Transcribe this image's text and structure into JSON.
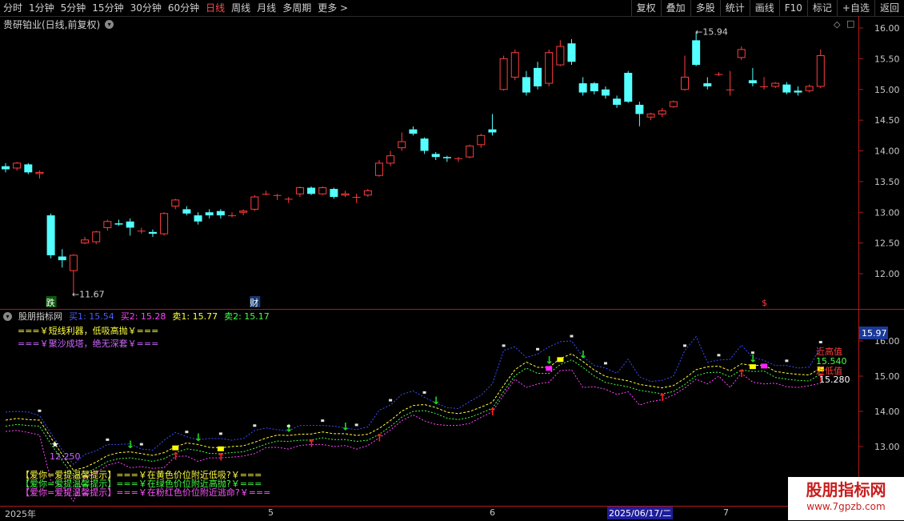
{
  "toolbar": {
    "left": [
      {
        "label": "分时",
        "active": false
      },
      {
        "label": "1分钟",
        "active": false
      },
      {
        "label": "5分钟",
        "active": false
      },
      {
        "label": "15分钟",
        "active": false
      },
      {
        "label": "30分钟",
        "active": false
      },
      {
        "label": "60分钟",
        "active": false
      },
      {
        "label": "日线",
        "active": true
      },
      {
        "label": "周线",
        "active": false
      },
      {
        "label": "月线",
        "active": false
      },
      {
        "label": "多周期",
        "active": false
      },
      {
        "label": "更多 >",
        "active": false
      }
    ],
    "right": [
      "复权",
      "叠加",
      "多股",
      "统计",
      "画线",
      "F10",
      "标记",
      "+自选",
      "返回"
    ]
  },
  "kline": {
    "title": "贵研铂业(日线,前复权)",
    "yticks": [
      "16.00",
      "15.50",
      "15.00",
      "14.50",
      "14.00",
      "13.50",
      "13.00",
      "12.50",
      "12.00"
    ],
    "high_label": "15.94",
    "low_label": "11.67",
    "marker_die": "跌",
    "marker_cai": "财",
    "marker_s": "$",
    "candles": [
      [
        13.75,
        13.7,
        13.8,
        13.65
      ],
      [
        13.72,
        13.8,
        13.82,
        13.68
      ],
      [
        13.78,
        13.65,
        13.8,
        13.62
      ],
      [
        13.63,
        13.65,
        13.68,
        13.55
      ],
      [
        12.95,
        12.3,
        12.98,
        12.25
      ],
      [
        12.28,
        12.22,
        12.4,
        12.1
      ],
      [
        12.05,
        12.3,
        12.32,
        11.67
      ],
      [
        12.5,
        12.55,
        12.6,
        12.48
      ],
      [
        12.52,
        12.68,
        12.7,
        12.48
      ],
      [
        12.75,
        12.85,
        12.88,
        12.7
      ],
      [
        12.82,
        12.8,
        12.88,
        12.78
      ],
      [
        12.85,
        12.75,
        12.9,
        12.62
      ],
      [
        12.7,
        12.7,
        12.75,
        12.65
      ],
      [
        12.68,
        12.65,
        12.72,
        12.6
      ],
      [
        12.65,
        12.98,
        13.0,
        12.62
      ],
      [
        13.1,
        13.2,
        13.22,
        13.05
      ],
      [
        13.05,
        12.98,
        13.1,
        12.95
      ],
      [
        12.95,
        12.85,
        13.0,
        12.8
      ],
      [
        13.0,
        12.95,
        13.05,
        12.9
      ],
      [
        13.02,
        12.95,
        13.05,
        12.9
      ],
      [
        12.95,
        12.95,
        13.0,
        12.92
      ],
      [
        13.0,
        13.02,
        13.05,
        12.95
      ],
      [
        13.05,
        13.25,
        13.28,
        13.02
      ],
      [
        13.3,
        13.3,
        13.35,
        13.28
      ],
      [
        13.28,
        13.28,
        13.3,
        13.2
      ],
      [
        13.22,
        13.22,
        13.25,
        13.15
      ],
      [
        13.3,
        13.4,
        13.42,
        13.25
      ],
      [
        13.4,
        13.3,
        13.42,
        13.28
      ],
      [
        13.3,
        13.4,
        13.42,
        13.28
      ],
      [
        13.38,
        13.25,
        13.4,
        13.22
      ],
      [
        13.28,
        13.3,
        13.35,
        13.25
      ],
      [
        13.25,
        13.25,
        13.3,
        13.15
      ],
      [
        13.28,
        13.35,
        13.38,
        13.25
      ],
      [
        13.6,
        13.8,
        13.85,
        13.58
      ],
      [
        13.8,
        13.92,
        14.0,
        13.75
      ],
      [
        14.05,
        14.15,
        14.3,
        14.0
      ],
      [
        14.35,
        14.28,
        14.4,
        14.25
      ],
      [
        14.2,
        14.0,
        14.22,
        13.95
      ],
      [
        13.95,
        13.9,
        13.98,
        13.85
      ],
      [
        13.9,
        13.88,
        13.92,
        13.82
      ],
      [
        13.88,
        13.88,
        13.9,
        13.82
      ],
      [
        13.9,
        14.08,
        14.1,
        13.88
      ],
      [
        14.1,
        14.25,
        14.28,
        14.05
      ],
      [
        14.35,
        14.3,
        14.6,
        14.25
      ],
      [
        15.0,
        15.5,
        15.55,
        14.98
      ],
      [
        15.2,
        15.6,
        15.65,
        15.15
      ],
      [
        15.2,
        14.95,
        15.3,
        14.9
      ],
      [
        15.35,
        15.05,
        15.45,
        15.0
      ],
      [
        15.1,
        15.6,
        15.65,
        15.05
      ],
      [
        15.4,
        15.7,
        15.8,
        15.38
      ],
      [
        15.75,
        15.45,
        15.82,
        15.4
      ],
      [
        15.1,
        14.95,
        15.2,
        14.9
      ],
      [
        15.1,
        14.97,
        15.12,
        14.92
      ],
      [
        15.0,
        14.9,
        15.05,
        14.85
      ],
      [
        14.85,
        14.75,
        14.9,
        14.7
      ],
      [
        15.27,
        14.8,
        15.3,
        14.78
      ],
      [
        14.75,
        14.6,
        14.8,
        14.4
      ],
      [
        14.55,
        14.6,
        14.62,
        14.5
      ],
      [
        14.6,
        14.65,
        14.7,
        14.55
      ],
      [
        14.72,
        14.8,
        14.82,
        14.7
      ],
      [
        15.0,
        15.2,
        15.55,
        14.98
      ],
      [
        15.8,
        15.4,
        15.94,
        15.38
      ],
      [
        15.1,
        15.05,
        15.2,
        15.0
      ],
      [
        15.25,
        15.25,
        15.28,
        15.22
      ],
      [
        15.0,
        15.0,
        15.3,
        14.9
      ],
      [
        15.52,
        15.65,
        15.7,
        15.48
      ],
      [
        15.15,
        15.1,
        15.35,
        15.05
      ],
      [
        15.05,
        15.05,
        15.2,
        15.0
      ],
      [
        15.05,
        15.1,
        15.12,
        15.02
      ],
      [
        15.08,
        14.95,
        15.12,
        14.92
      ],
      [
        14.98,
        14.95,
        15.05,
        14.9
      ],
      [
        14.98,
        15.05,
        15.08,
        14.95
      ],
      [
        15.05,
        15.55,
        15.65,
        15.02
      ]
    ]
  },
  "indicator": {
    "name": "股朋指标网",
    "legend": [
      {
        "label": "买1: 15.54",
        "color": "#4a5cff"
      },
      {
        "label": "买2: 15.28",
        "color": "#ff44ff"
      },
      {
        "label": "卖1: 15.77",
        "color": "#ffff44"
      },
      {
        "label": "卖2: 15.17",
        "color": "#44ff44"
      }
    ],
    "tip1": "===￥短线利器，低吸高抛￥===",
    "tip2": "===￥聚沙成塔，绝无深套￥===",
    "yticks": [
      "16.00",
      "15.00",
      "14.00",
      "13.00"
    ],
    "current_value": "15.97",
    "near_high": "近高值",
    "near_low": "近低值",
    "val_1": "15.540",
    "val_2": "15.280",
    "low_value": "12.250",
    "remind1": "【爱你=爱提温馨提示】===￥在黄色价位附近低吸?￥===",
    "remind2": "【爱你=爱提温馨提示】===￥在绿色价位附近高抛?￥===",
    "remind3": "【爱你=爱提温馨提示】===￥在粉红色价位附近逃命?￥==="
  },
  "timeline": {
    "year": "2025年",
    "months": [
      "5",
      "6",
      "7"
    ],
    "cursor_date": "2025/06/17/二"
  },
  "watermark": {
    "title": "股朋指标网",
    "url": "www.7gpzb.com"
  },
  "colors": {
    "up": "#ff3c3c",
    "down": "#54ffff",
    "axis": "#b0191b"
  }
}
